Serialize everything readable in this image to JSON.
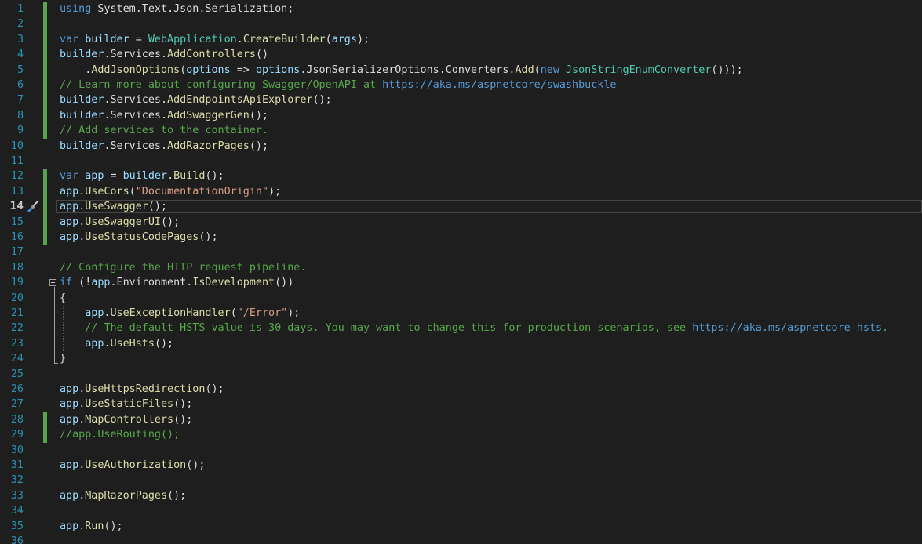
{
  "editor": {
    "current_line": 14,
    "lines": [
      {
        "n": "1",
        "bar": true,
        "tokens": [
          [
            "kw",
            "using"
          ],
          [
            "pl",
            " System.Text.Json.Serialization;"
          ]
        ]
      },
      {
        "n": "2",
        "bar": true,
        "tokens": []
      },
      {
        "n": "3",
        "bar": true,
        "tokens": [
          [
            "kw",
            "var"
          ],
          [
            "pl",
            " "
          ],
          [
            "lv",
            "builder"
          ],
          [
            "pl",
            " = "
          ],
          [
            "ty",
            "WebApplication"
          ],
          [
            "pl",
            "."
          ],
          [
            "mt",
            "CreateBuilder"
          ],
          [
            "pl",
            "("
          ],
          [
            "lv",
            "args"
          ],
          [
            "pl",
            ");"
          ]
        ]
      },
      {
        "n": "4",
        "bar": true,
        "tokens": [
          [
            "lv",
            "builder"
          ],
          [
            "pl",
            ".Services."
          ],
          [
            "mt",
            "AddControllers"
          ],
          [
            "pl",
            "()"
          ]
        ]
      },
      {
        "n": "5",
        "bar": true,
        "tokens": [
          [
            "pl",
            "    ."
          ],
          [
            "mt",
            "AddJsonOptions"
          ],
          [
            "pl",
            "("
          ],
          [
            "lv",
            "options"
          ],
          [
            "pl",
            " => "
          ],
          [
            "lv",
            "options"
          ],
          [
            "pl",
            ".JsonSerializerOptions.Converters."
          ],
          [
            "mt",
            "Add"
          ],
          [
            "pl",
            "("
          ],
          [
            "kw",
            "new"
          ],
          [
            "pl",
            " "
          ],
          [
            "ty",
            "JsonStringEnumConverter"
          ],
          [
            "pl",
            "()));"
          ]
        ]
      },
      {
        "n": "6",
        "bar": true,
        "tokens": [
          [
            "cm",
            "// Learn more about configuring Swagger/OpenAPI at "
          ],
          [
            "lk",
            "https://aka.ms/aspnetcore/swashbuckle"
          ]
        ]
      },
      {
        "n": "7",
        "bar": true,
        "tokens": [
          [
            "lv",
            "builder"
          ],
          [
            "pl",
            ".Services."
          ],
          [
            "mt",
            "AddEndpointsApiExplorer"
          ],
          [
            "pl",
            "();"
          ]
        ]
      },
      {
        "n": "8",
        "bar": true,
        "tokens": [
          [
            "lv",
            "builder"
          ],
          [
            "pl",
            ".Services."
          ],
          [
            "mt",
            "AddSwaggerGen"
          ],
          [
            "pl",
            "();"
          ]
        ]
      },
      {
        "n": "9",
        "bar": true,
        "tokens": [
          [
            "cm",
            "// Add services to the container."
          ]
        ]
      },
      {
        "n": "10",
        "bar": false,
        "tokens": [
          [
            "lv",
            "builder"
          ],
          [
            "pl",
            ".Services."
          ],
          [
            "mt",
            "AddRazorPages"
          ],
          [
            "pl",
            "();"
          ]
        ]
      },
      {
        "n": "11",
        "bar": false,
        "tokens": []
      },
      {
        "n": "12",
        "bar": true,
        "tokens": [
          [
            "kw",
            "var"
          ],
          [
            "pl",
            " "
          ],
          [
            "lv",
            "app"
          ],
          [
            "pl",
            " = "
          ],
          [
            "lv",
            "builder"
          ],
          [
            "pl",
            "."
          ],
          [
            "mt",
            "Build"
          ],
          [
            "pl",
            "();"
          ]
        ]
      },
      {
        "n": "13",
        "bar": true,
        "tokens": [
          [
            "lv",
            "app"
          ],
          [
            "pl",
            "."
          ],
          [
            "mt",
            "UseCors"
          ],
          [
            "pl",
            "("
          ],
          [
            "st",
            "\"DocumentationOrigin\""
          ],
          [
            "pl",
            ");"
          ]
        ]
      },
      {
        "n": "14",
        "bar": true,
        "tokens": [
          [
            "lv",
            "app"
          ],
          [
            "pl",
            "."
          ],
          [
            "mt",
            "UseSwagger"
          ],
          [
            "pl",
            "();"
          ]
        ]
      },
      {
        "n": "15",
        "bar": true,
        "tokens": [
          [
            "lv",
            "app"
          ],
          [
            "pl",
            "."
          ],
          [
            "mt",
            "UseSwaggerUI"
          ],
          [
            "pl",
            "();"
          ]
        ]
      },
      {
        "n": "16",
        "bar": true,
        "tokens": [
          [
            "lv",
            "app"
          ],
          [
            "pl",
            "."
          ],
          [
            "mt",
            "UseStatusCodePages"
          ],
          [
            "pl",
            "();"
          ]
        ]
      },
      {
        "n": "17",
        "bar": false,
        "tokens": []
      },
      {
        "n": "18",
        "bar": false,
        "tokens": [
          [
            "cm",
            "// Configure the HTTP request pipeline."
          ]
        ]
      },
      {
        "n": "19",
        "bar": false,
        "tokens": [
          [
            "kw",
            "if"
          ],
          [
            "pl",
            " (!"
          ],
          [
            "lv",
            "app"
          ],
          [
            "pl",
            ".Environment."
          ],
          [
            "mt",
            "IsDevelopment"
          ],
          [
            "pl",
            "())"
          ]
        ]
      },
      {
        "n": "20",
        "bar": false,
        "tokens": [
          [
            "pl",
            "{"
          ]
        ]
      },
      {
        "n": "21",
        "bar": false,
        "tokens": [
          [
            "pl",
            "    "
          ],
          [
            "lv",
            "app"
          ],
          [
            "pl",
            "."
          ],
          [
            "mt",
            "UseExceptionHandler"
          ],
          [
            "pl",
            "("
          ],
          [
            "st",
            "\"/Error\""
          ],
          [
            "pl",
            ");"
          ]
        ]
      },
      {
        "n": "22",
        "bar": false,
        "tokens": [
          [
            "cm",
            "    // The default HSTS value is 30 days. You may want to change this for production scenarios, see "
          ],
          [
            "lk",
            "https://aka.ms/aspnetcore-hsts"
          ],
          [
            "cm",
            "."
          ]
        ]
      },
      {
        "n": "23",
        "bar": false,
        "tokens": [
          [
            "pl",
            "    "
          ],
          [
            "lv",
            "app"
          ],
          [
            "pl",
            "."
          ],
          [
            "mt",
            "UseHsts"
          ],
          [
            "pl",
            "();"
          ]
        ]
      },
      {
        "n": "24",
        "bar": false,
        "tokens": [
          [
            "pl",
            "}"
          ]
        ]
      },
      {
        "n": "25",
        "bar": false,
        "tokens": []
      },
      {
        "n": "26",
        "bar": false,
        "tokens": [
          [
            "lv",
            "app"
          ],
          [
            "pl",
            "."
          ],
          [
            "mt",
            "UseHttpsRedirection"
          ],
          [
            "pl",
            "();"
          ]
        ]
      },
      {
        "n": "27",
        "bar": false,
        "tokens": [
          [
            "lv",
            "app"
          ],
          [
            "pl",
            "."
          ],
          [
            "mt",
            "UseStaticFiles"
          ],
          [
            "pl",
            "();"
          ]
        ]
      },
      {
        "n": "28",
        "bar": true,
        "tokens": [
          [
            "lv",
            "app"
          ],
          [
            "pl",
            "."
          ],
          [
            "mt",
            "MapControllers"
          ],
          [
            "pl",
            "();"
          ]
        ]
      },
      {
        "n": "29",
        "bar": true,
        "tokens": [
          [
            "cm",
            "//app.UseRouting();"
          ]
        ]
      },
      {
        "n": "30",
        "bar": false,
        "tokens": []
      },
      {
        "n": "31",
        "bar": false,
        "tokens": [
          [
            "lv",
            "app"
          ],
          [
            "pl",
            "."
          ],
          [
            "mt",
            "UseAuthorization"
          ],
          [
            "pl",
            "();"
          ]
        ]
      },
      {
        "n": "32",
        "bar": false,
        "tokens": []
      },
      {
        "n": "33",
        "bar": false,
        "tokens": [
          [
            "lv",
            "app"
          ],
          [
            "pl",
            "."
          ],
          [
            "mt",
            "MapRazorPages"
          ],
          [
            "pl",
            "();"
          ]
        ]
      },
      {
        "n": "34",
        "bar": false,
        "tokens": []
      },
      {
        "n": "35",
        "bar": false,
        "tokens": [
          [
            "lv",
            "app"
          ],
          [
            "pl",
            "."
          ],
          [
            "mt",
            "Run"
          ],
          [
            "pl",
            "();"
          ]
        ]
      },
      {
        "n": "36",
        "bar": false,
        "tokens": []
      }
    ]
  },
  "icons": {
    "gutter_action": "paintbrush-icon",
    "fold_toggle": "collapse-icon"
  },
  "colors": {
    "background": "#1e1e1e",
    "line_number": "#2b91af",
    "change_bar": "#57a64a",
    "keyword": "#569cd6",
    "type": "#4ec9b0",
    "method": "#dcdcaa",
    "variable": "#9cdcfe",
    "string": "#d69d85",
    "comment": "#57a64a"
  }
}
